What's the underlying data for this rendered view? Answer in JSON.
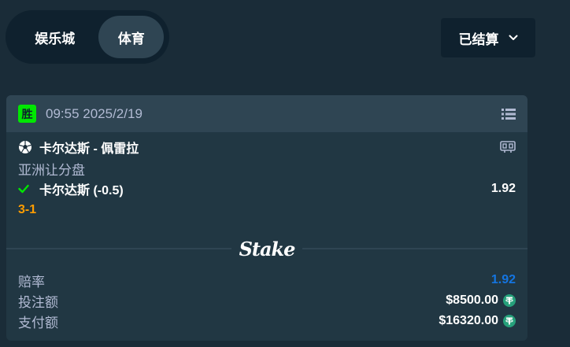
{
  "tabs": [
    {
      "label": "娱乐城"
    },
    {
      "label": "体育",
      "active": true
    }
  ],
  "filter": {
    "label": "已结算"
  },
  "bet": {
    "status_badge": "胜",
    "timestamp": "09:55 2025/2/19",
    "match": "卡尔达斯 - 佩雷拉",
    "market": "亚洲让分盘",
    "selection": "卡尔达斯 (-0.5)",
    "selection_odds": "1.92",
    "score": "3-1",
    "logo_text": "Stake",
    "summary": [
      {
        "label": "赔率",
        "value": "1.92"
      },
      {
        "label": "投注额",
        "value": "$8500.00"
      },
      {
        "label": "支付额",
        "value": "$16320.00"
      }
    ]
  },
  "icons": {
    "sport": "soccer-ball-icon",
    "check": "checkmark-icon",
    "menu": "list-icon",
    "stats": "scoreboard-icon",
    "currency": "tether-coin-icon",
    "chevron": "chevron-down-icon"
  },
  "colors": {
    "background": "#1a2c38",
    "card": "#213743",
    "header": "#2f4553",
    "win_green": "#00e701",
    "score_orange": "#ff9d00",
    "odds_blue": "#1475e1",
    "tether_green": "#26a17b"
  }
}
